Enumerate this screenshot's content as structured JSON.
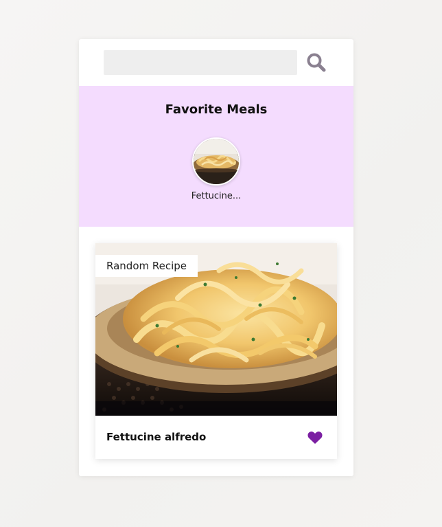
{
  "search": {
    "value": "",
    "icon": "search-icon",
    "icon_color": "#8a8090"
  },
  "favorites": {
    "title": "Favorite Meals",
    "background": "#f4dcfe",
    "items": [
      {
        "name": "Fettucine...",
        "icon": "pasta-thumbnail"
      }
    ]
  },
  "random_meal": {
    "tag": "Random Recipe",
    "name": "Fettucine alfredo",
    "image": "fettuccine-alfredo-photo",
    "favorite_icon": "heart-icon",
    "favorite_color": "#7b1fa2"
  }
}
